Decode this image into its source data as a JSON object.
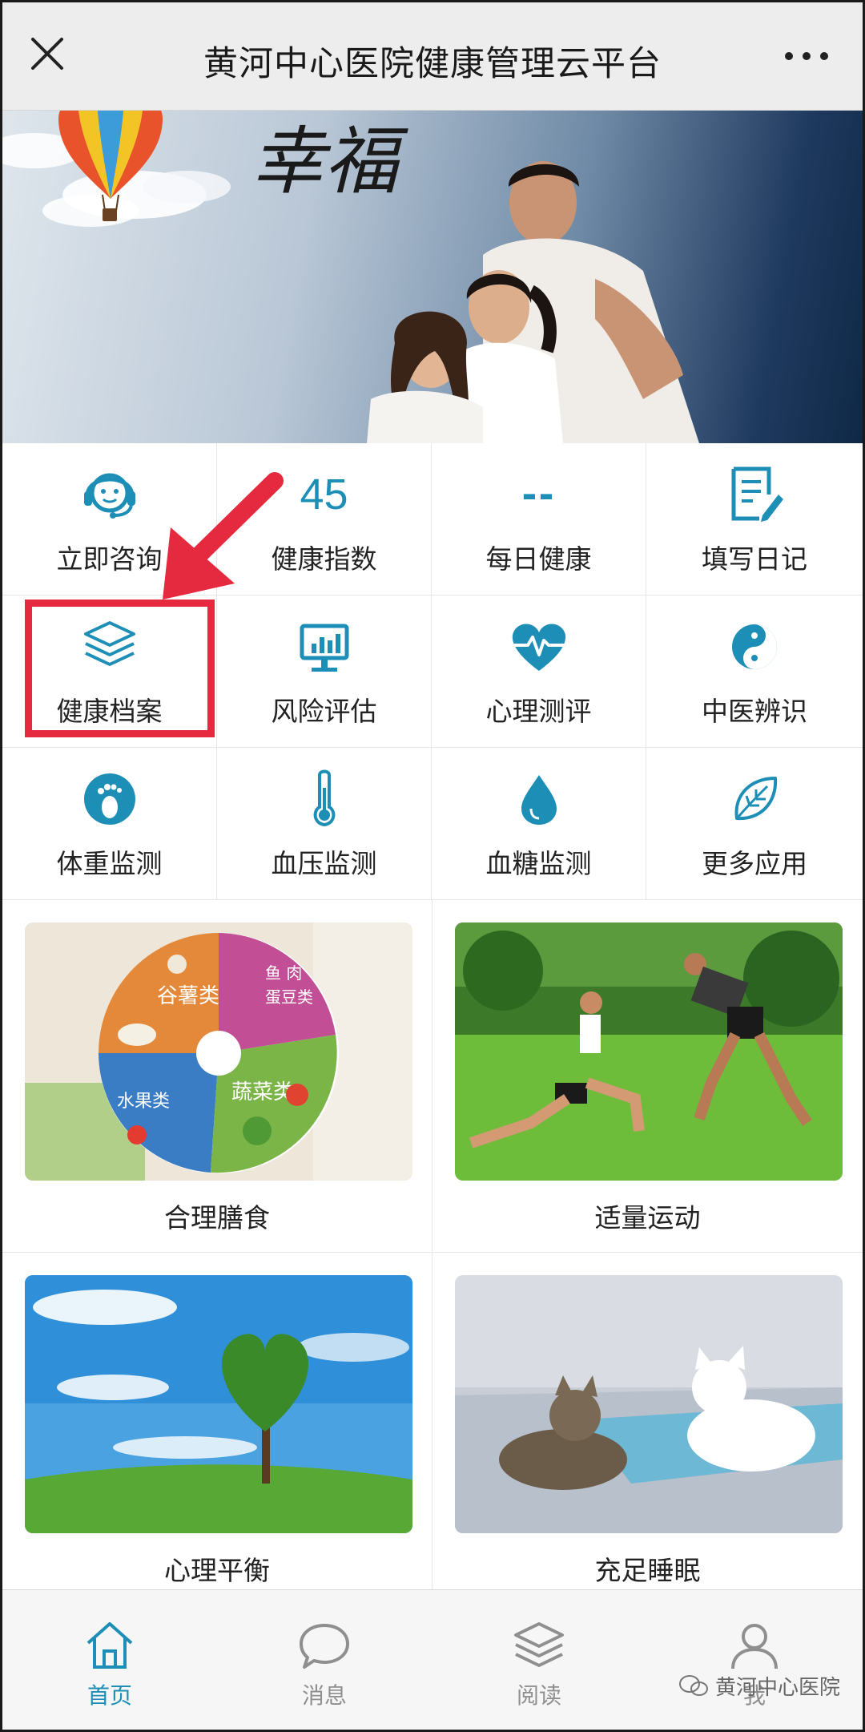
{
  "header": {
    "title": "黄河中心医院健康管理云平台",
    "close_icon": "close-icon",
    "more_icon": "more-dots-icon"
  },
  "banner": {
    "calligraphy": "幸福"
  },
  "grid": [
    {
      "label": "立即咨询",
      "icon": "headset-agent-icon"
    },
    {
      "label": "健康指数",
      "value": "45"
    },
    {
      "label": "每日健康",
      "value": "--"
    },
    {
      "label": "填写日记",
      "icon": "edit-note-icon"
    },
    {
      "label": "健康档案",
      "icon": "layers-icon"
    },
    {
      "label": "风险评估",
      "icon": "monitor-chart-icon"
    },
    {
      "label": "心理测评",
      "icon": "heart-pulse-icon"
    },
    {
      "label": "中医辨识",
      "icon": "yin-yang-icon"
    },
    {
      "label": "体重监测",
      "icon": "footprint-icon"
    },
    {
      "label": "血压监测",
      "icon": "thermometer-icon"
    },
    {
      "label": "血糖监测",
      "icon": "blood-drop-icon"
    },
    {
      "label": "更多应用",
      "icon": "leaf-icon"
    }
  ],
  "cards": [
    {
      "caption": "合理膳食"
    },
    {
      "caption": "适量运动"
    },
    {
      "caption": "心理平衡"
    },
    {
      "caption": "充足睡眠"
    }
  ],
  "food_plate_labels": {
    "grains": "谷薯类",
    "fish": "鱼 肉",
    "eggs": "蛋豆类",
    "fruit": "水果类",
    "veg": "蔬菜类"
  },
  "bottom_nav": [
    {
      "label": "首页",
      "icon": "home-icon",
      "active": true
    },
    {
      "label": "消息",
      "icon": "chat-bubble-icon",
      "active": false
    },
    {
      "label": "阅读",
      "icon": "layers-stack-icon",
      "active": false
    },
    {
      "label": "我",
      "icon": "user-icon",
      "active": false
    }
  ],
  "watermark": "黄河中心医院",
  "colors": {
    "accent": "#1d8fb7",
    "highlight": "#e5293e",
    "topbar_bg": "#ededed"
  }
}
